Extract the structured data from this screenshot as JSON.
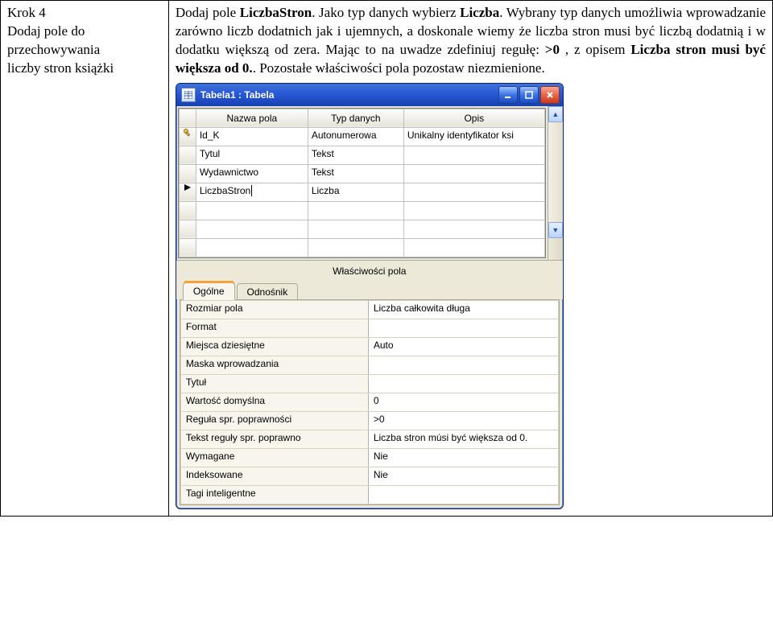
{
  "left": {
    "step": "Krok 4",
    "line2": "Dodaj pole do",
    "line3": "przechowywania",
    "line4": "liczby stron książki"
  },
  "desc": {
    "p1a": "Dodaj pole ",
    "p1b": "LiczbaStron",
    "p1c": ". Jako typ danych wybierz ",
    "p1d": "Liczba",
    "p1e": ". Wybrany typ danych umożliwia wprowadzanie zarówno liczb dodatnich jak i ujemnych, a doskonale wiemy że liczba stron musi być liczbą dodatnią i w dodatku większą od zera. Mając to na uwadze zdefiniuj regułę: ",
    "p1f": ">0",
    "p1g": " , z opisem ",
    "p1h": "Liczba stron musi być większa od 0.",
    "p1i": ". Pozostałe właściwości pola pozostaw niezmienione."
  },
  "window": {
    "title": "Tabela1 : Tabela"
  },
  "grid": {
    "headers": {
      "name": "Nazwa pola",
      "type": "Typ danych",
      "desc": "Opis"
    },
    "rows": [
      {
        "name": "Id_K",
        "type": "Autonumerowa",
        "desc": "Unikalny identyfikator ksi",
        "pk": true
      },
      {
        "name": "Tytul",
        "type": "Tekst",
        "desc": ""
      },
      {
        "name": "Wydawnictwo",
        "type": "Tekst",
        "desc": ""
      },
      {
        "name": "LiczbaStron",
        "type": "Liczba",
        "desc": "",
        "editing": true
      }
    ]
  },
  "propsHeader": "Właściwości pola",
  "tabs": {
    "general": "Ogólne",
    "lookup": "Odnośnik"
  },
  "props": [
    {
      "label": "Rozmiar pola",
      "value": "Liczba całkowita długa"
    },
    {
      "label": "Format",
      "value": ""
    },
    {
      "label": "Miejsca dziesiętne",
      "value": "Auto"
    },
    {
      "label": "Maska wprowadzania",
      "value": ""
    },
    {
      "label": "Tytuł",
      "value": ""
    },
    {
      "label": "Wartość domyślna",
      "value": "0"
    },
    {
      "label": "Reguła spr. poprawności",
      "value": ">0"
    },
    {
      "label": "Tekst reguły spr. poprawno",
      "value": "Liczba stron músi być większa od 0."
    },
    {
      "label": "Wymagane",
      "value": "Nie"
    },
    {
      "label": "Indeksowane",
      "value": "Nie"
    },
    {
      "label": "Tagi inteligentne",
      "value": ""
    }
  ]
}
